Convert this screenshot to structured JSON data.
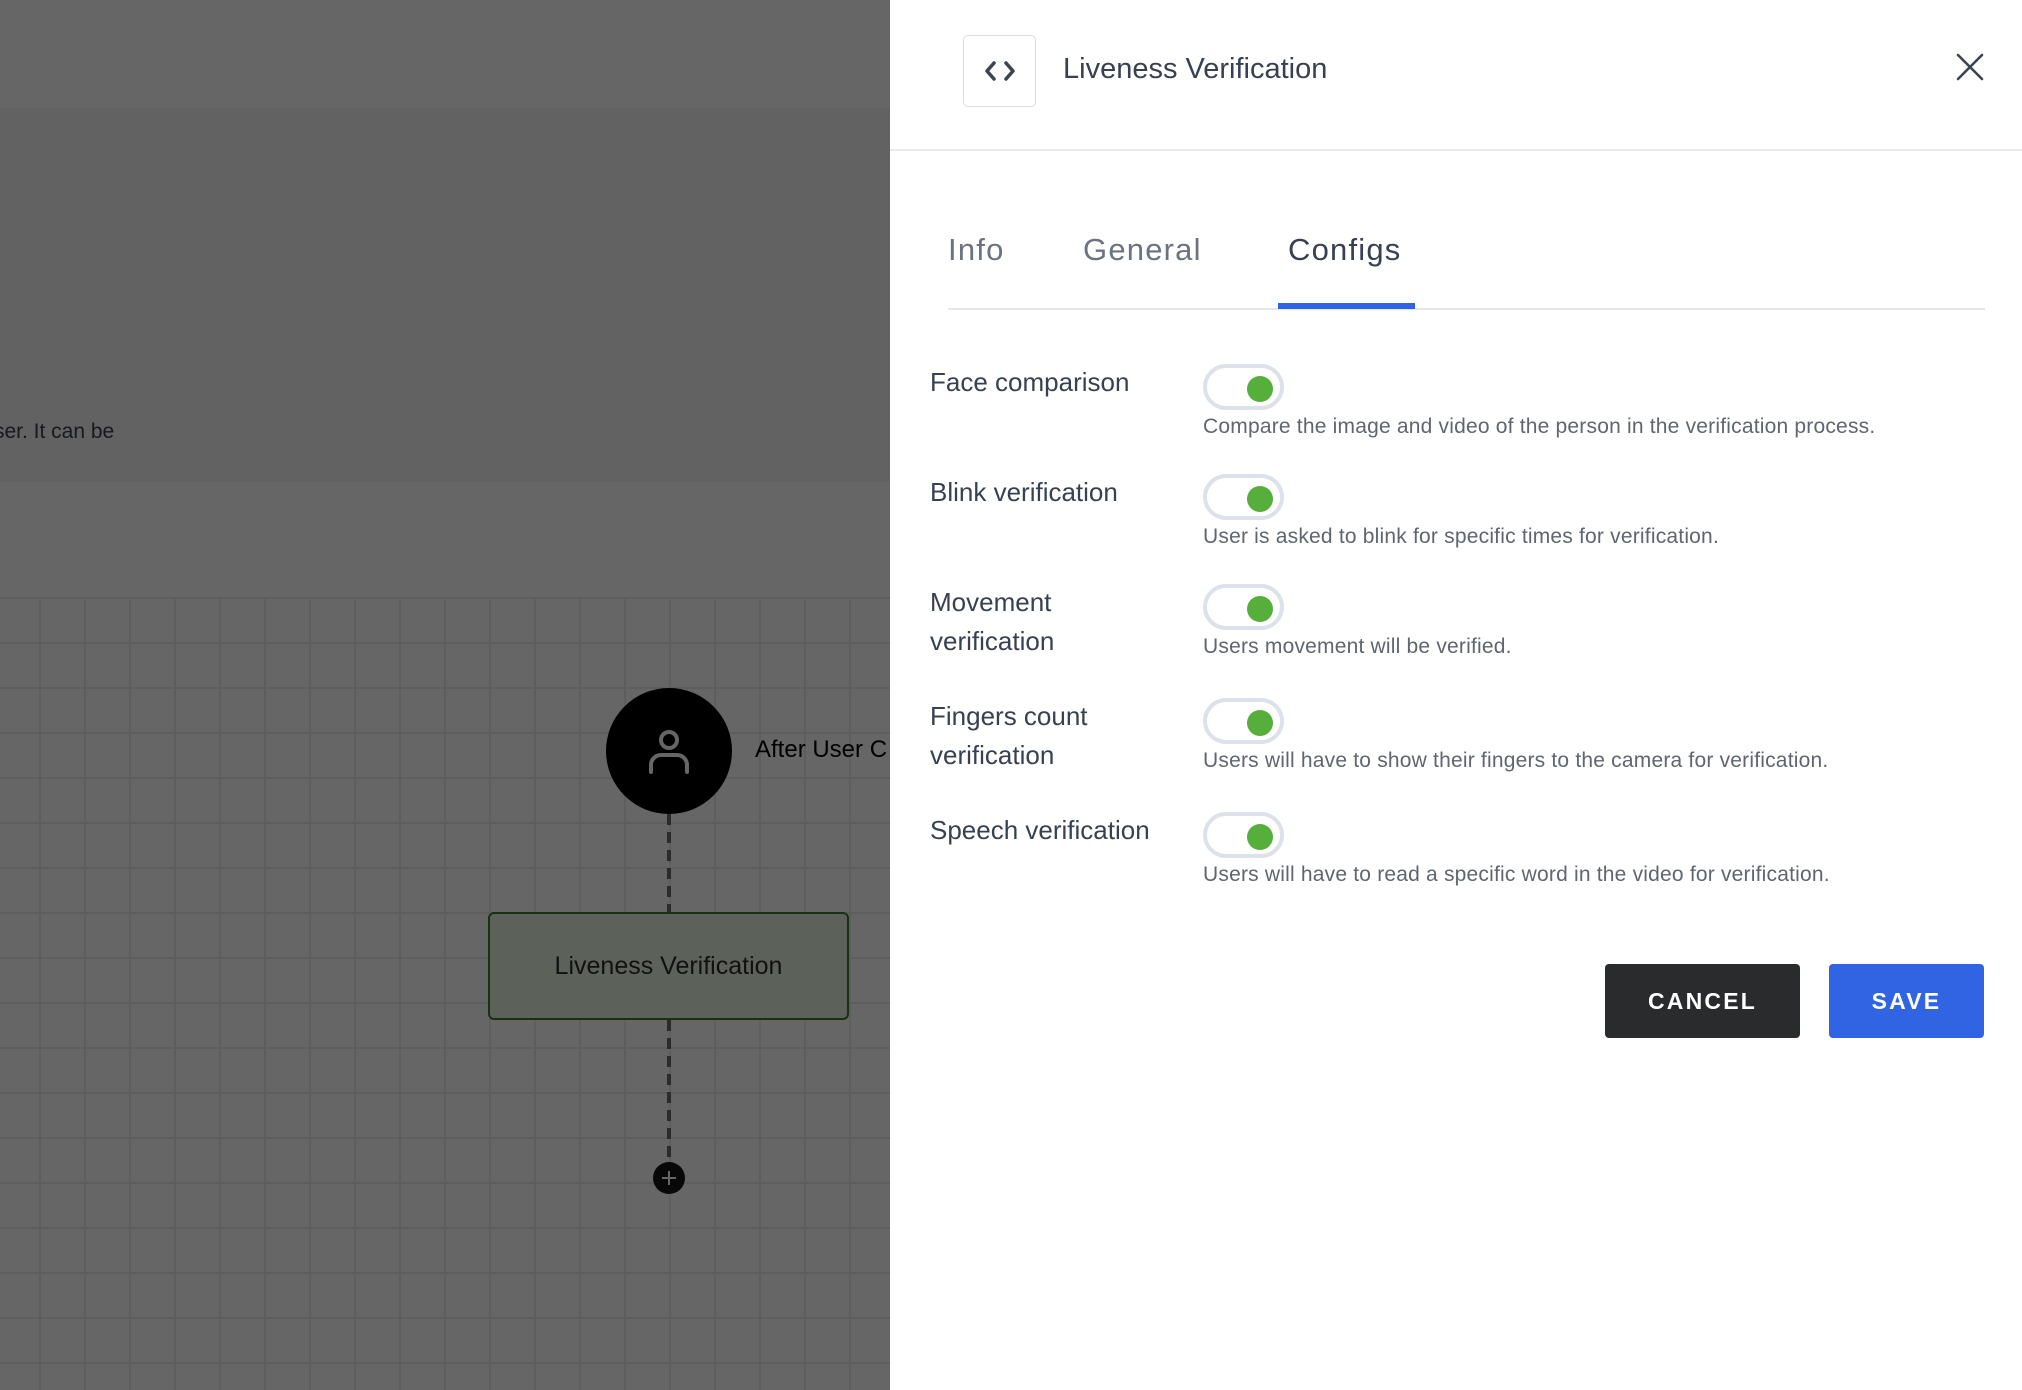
{
  "background": {
    "info_text_fragment": "ser. It can be",
    "flow": {
      "trigger_label": "After User C",
      "trigger_icon": "user-icon",
      "step_label": "Liveness Verification",
      "add_icon": "plus-icon"
    }
  },
  "drawer": {
    "header": {
      "icon": "code-icon",
      "title": "Liveness Verification",
      "close_icon": "close-icon"
    },
    "tabs": [
      {
        "label": "Info",
        "active": false
      },
      {
        "label": "General",
        "active": false
      },
      {
        "label": "Configs",
        "active": true
      }
    ],
    "configs": [
      {
        "label": "Face comparison",
        "enabled": true,
        "description": "Compare the image and video of the person in the verification process."
      },
      {
        "label": "Blink verification",
        "enabled": true,
        "description": "User is asked to blink for specific times for verification."
      },
      {
        "label": "Movement verification",
        "enabled": true,
        "description": "Users movement will be verified."
      },
      {
        "label": "Fingers count verification",
        "enabled": true,
        "description": "Users will have to show their fingers to the camera for verification."
      },
      {
        "label": "Speech verification",
        "enabled": true,
        "description": "Users will have to read a specific word in the video for verification."
      }
    ],
    "buttons": {
      "cancel_label": "CANCEL",
      "save_label": "SAVE"
    }
  },
  "colors": {
    "accent": "#2f63e3",
    "toggle_on": "#56ae3b",
    "cancel_bg": "#2a2b2d",
    "overlay": "rgba(0,0,0,0.6)"
  }
}
